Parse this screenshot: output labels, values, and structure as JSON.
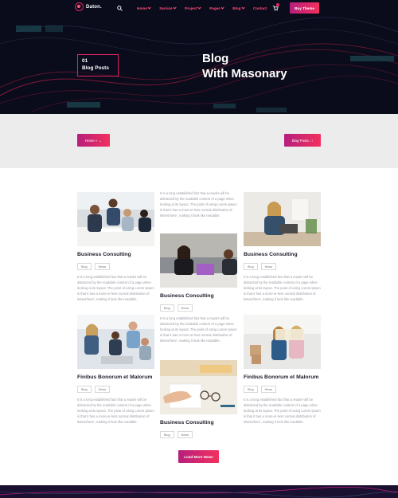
{
  "header": {
    "logo_text": "Daton.",
    "nav": [
      {
        "label": "Home",
        "has_dropdown": true
      },
      {
        "label": "Service",
        "has_dropdown": true
      },
      {
        "label": "Project",
        "has_dropdown": true
      },
      {
        "label": "Pages",
        "has_dropdown": true
      },
      {
        "label": "Blog",
        "has_dropdown": true
      },
      {
        "label": "Contact",
        "has_dropdown": false
      }
    ],
    "buy_button": "Buy Theme",
    "icons": [
      "search-icon",
      "cart-icon"
    ]
  },
  "hero": {
    "number": "01",
    "label": "Blog Posts",
    "title_line1": "Blog",
    "title_line2": "With Masonary"
  },
  "breadcrumb": {
    "home": "Home » →",
    "current": "Blog Posts ↓↑"
  },
  "cards": {
    "c1": {
      "title": "Business Consulting",
      "tags": [
        "Blog",
        "News"
      ],
      "text": "It is a long established fact that a reader will be distracted by the readable content of a page when looking at its layout. The point of using Lorem Ipsum is that it has a more-or-less normal distribution of letters/here', making it look like readable."
    },
    "c2": {
      "text": "It is a long established fact that a reader will be distracted by the readable content of a page when looking at its layout. The point of using Lorem Ipsum is that it has a more-or-less normal distribution of letters/here', making it look like readable."
    },
    "c3": {
      "title": "Business Consulting",
      "tags": [
        "Blog",
        "News"
      ],
      "text": "It is a long established fact that a reader will be distracted by the readable content of a page when looking at its layout. The point of using Lorem Ipsum is that it has a more-or-less normal distribution of letters/here', making it look like readable."
    },
    "c4": {
      "title": "Business Consulting",
      "tags": [
        "Blog",
        "News"
      ]
    },
    "c5": {
      "title": "Finibus Bonorum et Malorum",
      "tags": [
        "Blog",
        "News"
      ],
      "text": "It is a long established fact that a reader will be distracted by the readable content of a page when looking at its layout. The point of using Lorem Ipsum is that it has a more-or-less normal distribution of letters/here', making it look like readable."
    },
    "c6": {
      "text": "It is a long established fact that a reader will be distracted by the readable content of a page when looking at its layout. The point of using Lorem Ipsum is that it has a more-or-less normal distribution of letters/here', making it look like readable."
    },
    "c7": {
      "title": "Finibus Bonorum et Malorum",
      "tags": [
        "Blog",
        "News"
      ],
      "text": "It is a long established fact that a reader will be distracted by the readable content of a page when looking at its layout. The point of using Lorem Ipsum is that it has a more-or-less normal distribution of letters/here', making it look like readable."
    },
    "c8": {
      "title": "Business Consulting",
      "tags": [
        "Blog",
        "News"
      ]
    }
  },
  "load_more": "Load More News",
  "colors": {
    "accent": "#e0245e",
    "accent_dark": "#b61f7d",
    "hero_bg": "#0a0c1c",
    "band_bg": "#ececec",
    "body_text": "#9a9aa5"
  }
}
